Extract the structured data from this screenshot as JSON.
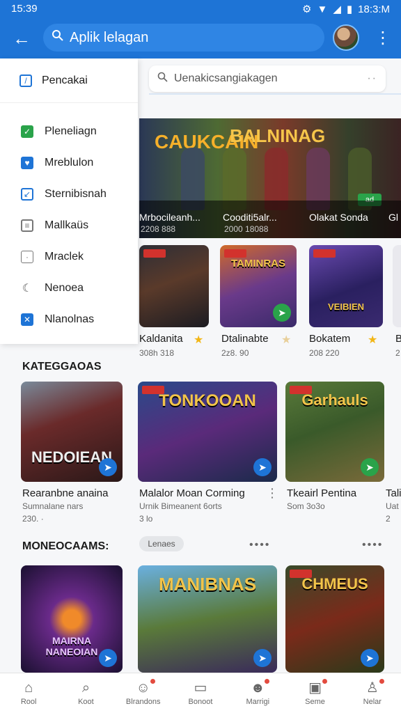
{
  "status": {
    "time": "15:39",
    "right_time": "18:3:M"
  },
  "appbar": {
    "search_text": "Aplik lelagan"
  },
  "subsearch": {
    "placeholder": "Uenakicsangiakagen"
  },
  "drawer": {
    "header": "Pencakai",
    "items": [
      {
        "label": "Pleneliagn",
        "color": "#2aa34a"
      },
      {
        "label": "Mreblulon",
        "color": "#1e74d6"
      },
      {
        "label": "Sternibisnah",
        "color": "#1e74d6"
      },
      {
        "label": "Mallkaüs",
        "color": "#777777"
      },
      {
        "label": "Mraclek",
        "color": "#777777"
      },
      {
        "label": "Nenoea",
        "color": "#777777"
      },
      {
        "label": "Nlanolnas",
        "color": "#1e74d6"
      }
    ]
  },
  "banner": {
    "title_left": "CAUKCAIN",
    "title_right": "BALNINAG",
    "tag": "ad",
    "captions": [
      {
        "name": "Mrbocileanh...",
        "sub": "2208 888"
      },
      {
        "name": "Cooditi5alr...",
        "sub": "2000 18088"
      },
      {
        "name": "Olakat Sonda",
        "sub": ""
      },
      {
        "name": "Gl",
        "sub": ""
      }
    ]
  },
  "row1": {
    "cards": [
      {
        "name": "Kaldanita",
        "sub": "308h 318",
        "art": ""
      },
      {
        "name": "Dtalinabte",
        "sub": "2z8. 90",
        "art": "TAMINRAS"
      },
      {
        "name": "Bokatem",
        "sub": "208 220",
        "art": "VEIBIEN"
      },
      {
        "name": "B",
        "sub": "2",
        "art": ""
      }
    ]
  },
  "sections": {
    "categories": "KATEGGAOAS",
    "more_games": "MONEOCAAMS:",
    "chip": "Lenaes"
  },
  "row2": {
    "cards": [
      {
        "name": "Rearanbne anaina",
        "sub": "Sumnalane nars",
        "sub2": "230. ·",
        "art": "NEDOIEAN"
      },
      {
        "name": "Malalor Moan Corming",
        "sub": "Urnik Bimeanent 6orts",
        "sub2": "3 lo",
        "art": "TONKOOAN"
      },
      {
        "name": "Tkeairl Pentina",
        "sub": "Som 3o3o",
        "sub2": "",
        "art": "Garhauls"
      },
      {
        "name": "Tali",
        "sub": "Uat",
        "sub2": "2",
        "art": ""
      }
    ]
  },
  "row3": {
    "cards": [
      {
        "art": "MAIRNA NANEOIAN"
      },
      {
        "art": "MANIBNAS"
      },
      {
        "art": "CHMEUS"
      }
    ]
  },
  "bottomnav": {
    "items": [
      {
        "label": "Rool",
        "icon": "home-icon"
      },
      {
        "label": "Koot",
        "icon": "search-icon"
      },
      {
        "label": "Blrandons",
        "icon": "chat-icon"
      },
      {
        "label": "Bonoot",
        "icon": "document-icon"
      },
      {
        "label": "Marrigi",
        "icon": "person-icon"
      },
      {
        "label": "Seme",
        "icon": "store-icon"
      },
      {
        "label": "Nelar",
        "icon": "profile-icon"
      }
    ]
  },
  "colors": {
    "accent": "#1e74d6",
    "green": "#2aa34a",
    "red": "#d2322d"
  }
}
